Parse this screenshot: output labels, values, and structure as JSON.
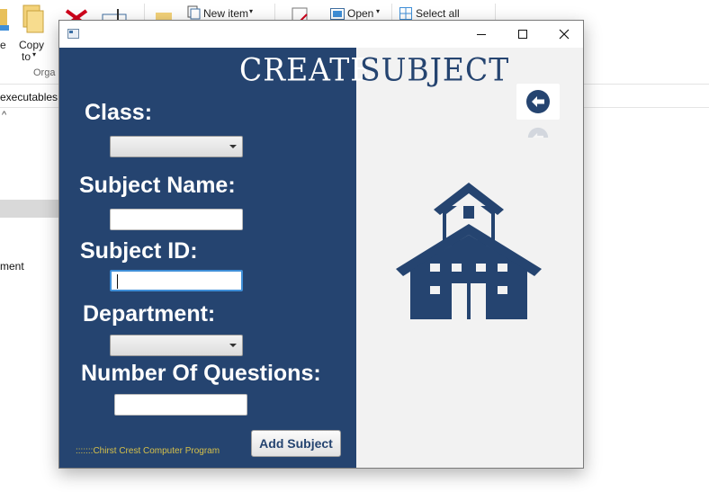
{
  "background": {
    "ribbon": {
      "copy_label_line1": "Copy",
      "copy_label_line2": "to",
      "left_cut_label": "e",
      "group_label": "Orga",
      "new_item_label": "New item",
      "open_label": "Open",
      "select_all_label": "Select all"
    },
    "address_text": "executables",
    "nav_item_text": "ment"
  },
  "window": {
    "title": "",
    "controls": {
      "minimize": "minimize",
      "maximize": "maximize",
      "close": "close"
    }
  },
  "form": {
    "title_left": "CREATE",
    "title_right": "SUBJECT",
    "class_label": "Class:",
    "class_value": "",
    "subject_name_label": "Subject Name:",
    "subject_name_value": "",
    "subject_id_label": "Subject ID:",
    "subject_id_value": "",
    "department_label": "Department:",
    "department_value": "",
    "questions_label": "Number Of Questions:",
    "questions_value": "",
    "add_button_label": "Add Subject",
    "footer_text": ":::::::Chirst Crest Computer Program"
  },
  "icons": {
    "back": "arrow-left-circle-icon",
    "illustration": "school-building-icon"
  },
  "colors": {
    "panel_blue": "#254470",
    "accent_blue": "#3f8fd8",
    "footer_gold": "#d6c04a",
    "close_red": "#d0021b"
  }
}
